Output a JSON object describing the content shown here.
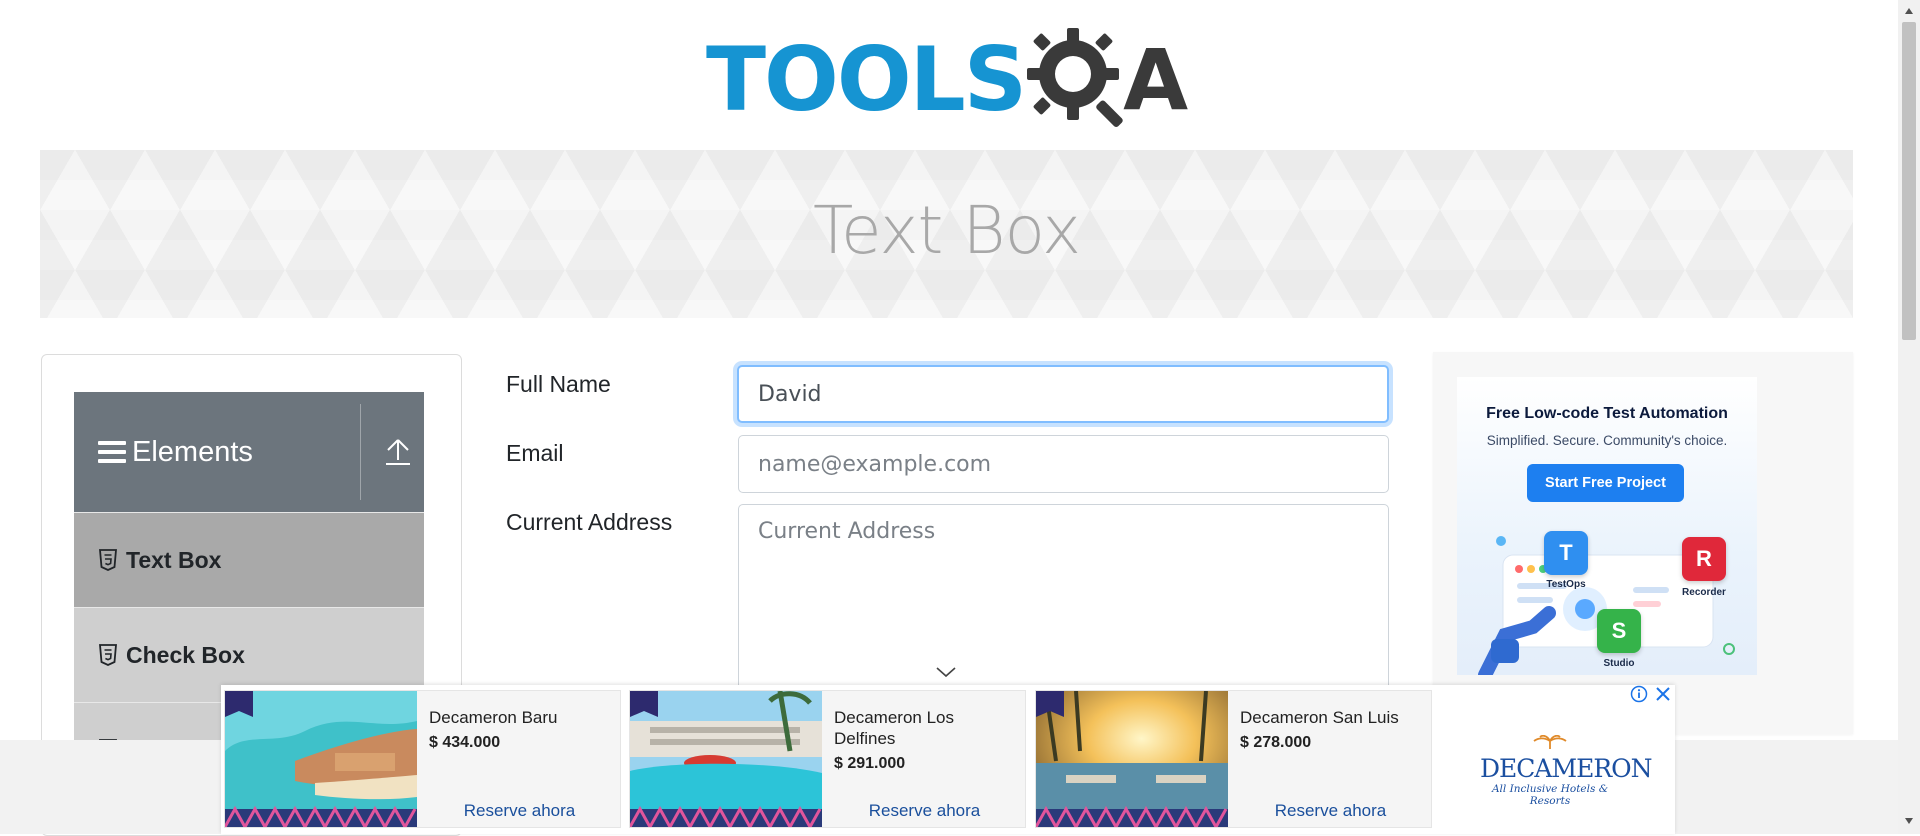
{
  "logo": {
    "text": "TOOLS",
    "suffix": "A"
  },
  "banner": {
    "title": "Text Box"
  },
  "sidebar": {
    "group_title": "Elements",
    "items": [
      {
        "label": "Text Box",
        "active": true
      },
      {
        "label": "Check Box",
        "active": false
      },
      {
        "label": "",
        "active": false
      }
    ]
  },
  "form": {
    "full_name": {
      "label": "Full Name",
      "value": "David"
    },
    "email": {
      "label": "Email",
      "placeholder": "name@example.com"
    },
    "current_address": {
      "label": "Current Address",
      "placeholder": "Current Address"
    }
  },
  "side_ad": {
    "headline": "Free Low-code Test Automation",
    "subline": "Simplified. Secure. Community's choice.",
    "button": "Start Free Project",
    "tiles": [
      {
        "letter": "T",
        "label": "TestOps",
        "color": "#2f8ff0"
      },
      {
        "letter": "R",
        "label": "Recorder",
        "color": "#e0283a"
      },
      {
        "letter": "S",
        "label": "Studio",
        "color": "#35b34a"
      }
    ]
  },
  "bottom_ad": {
    "hotels": [
      {
        "name": "Decameron Baru",
        "price": "$ 434.000",
        "cta": "Reserve ahora"
      },
      {
        "name": "Decameron Los Delfines",
        "price": "$ 291.000",
        "cta": "Reserve ahora"
      },
      {
        "name": "Decameron San Luis",
        "price": "$ 278.000",
        "cta": "Reserve ahora"
      }
    ],
    "brand": {
      "name": "DECAMERON",
      "tagline": "All Inclusive Hotels & Resorts"
    }
  },
  "colors": {
    "accent_blue": "#1694d2",
    "sidebar_header": "#6c757d",
    "active_item": "#a9a9a9",
    "focus_ring": "#80bdff",
    "link_blue": "#1a4f9c"
  }
}
